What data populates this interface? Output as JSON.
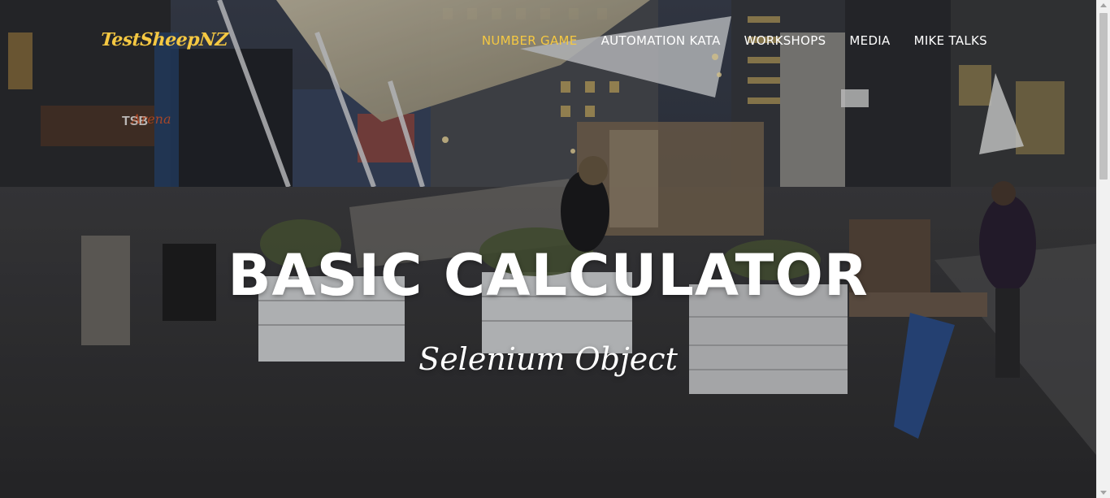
{
  "header": {
    "brand": "TestSheepNZ",
    "nav": [
      {
        "label": "NUMBER GAME",
        "active": true
      },
      {
        "label": "AUTOMATION KATA",
        "active": false
      },
      {
        "label": "WORKSHOPS",
        "active": false
      },
      {
        "label": "MEDIA",
        "active": false
      },
      {
        "label": "MIKE TALKS",
        "active": false
      }
    ]
  },
  "hero": {
    "title": "BASIC CALCULATOR",
    "subtitle": "Selenium Object"
  },
  "colors": {
    "accent": "#f5c842",
    "text": "#ffffff"
  }
}
